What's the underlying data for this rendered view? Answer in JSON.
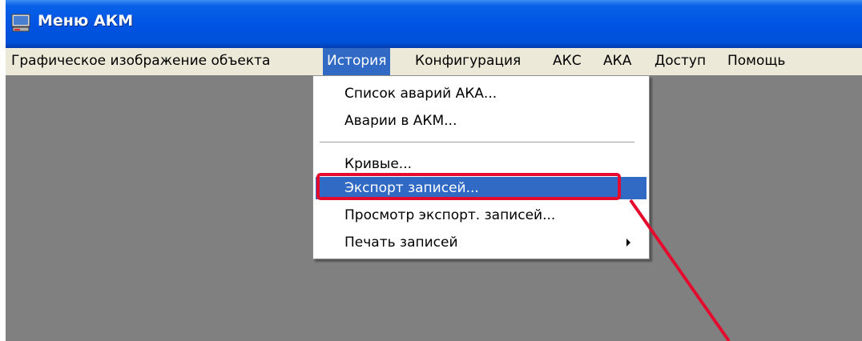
{
  "window": {
    "title": "Меню АКМ"
  },
  "menubar": {
    "items": [
      "Графическое изображение объекта",
      "История",
      "Конфигурация",
      "АКС",
      "АКА",
      "Доступ",
      "Помощь"
    ],
    "active": "История"
  },
  "history_menu": {
    "items": [
      "Список аварий АКА...",
      "Аварии в АКМ...",
      "Кривые...",
      "Экспорт записей...",
      "Просмотр экспорт. записей...",
      "Печать записей"
    ],
    "highlighted": "Экспорт записей..."
  },
  "colors": {
    "titlebar": "#0054e3",
    "menubar": "#ece9d8",
    "workspace": "#808080",
    "selection": "#316ac5",
    "annotation": "#e30b2e"
  },
  "icons": {
    "app": "app-icon",
    "submenu": "submenu-arrow-icon"
  }
}
